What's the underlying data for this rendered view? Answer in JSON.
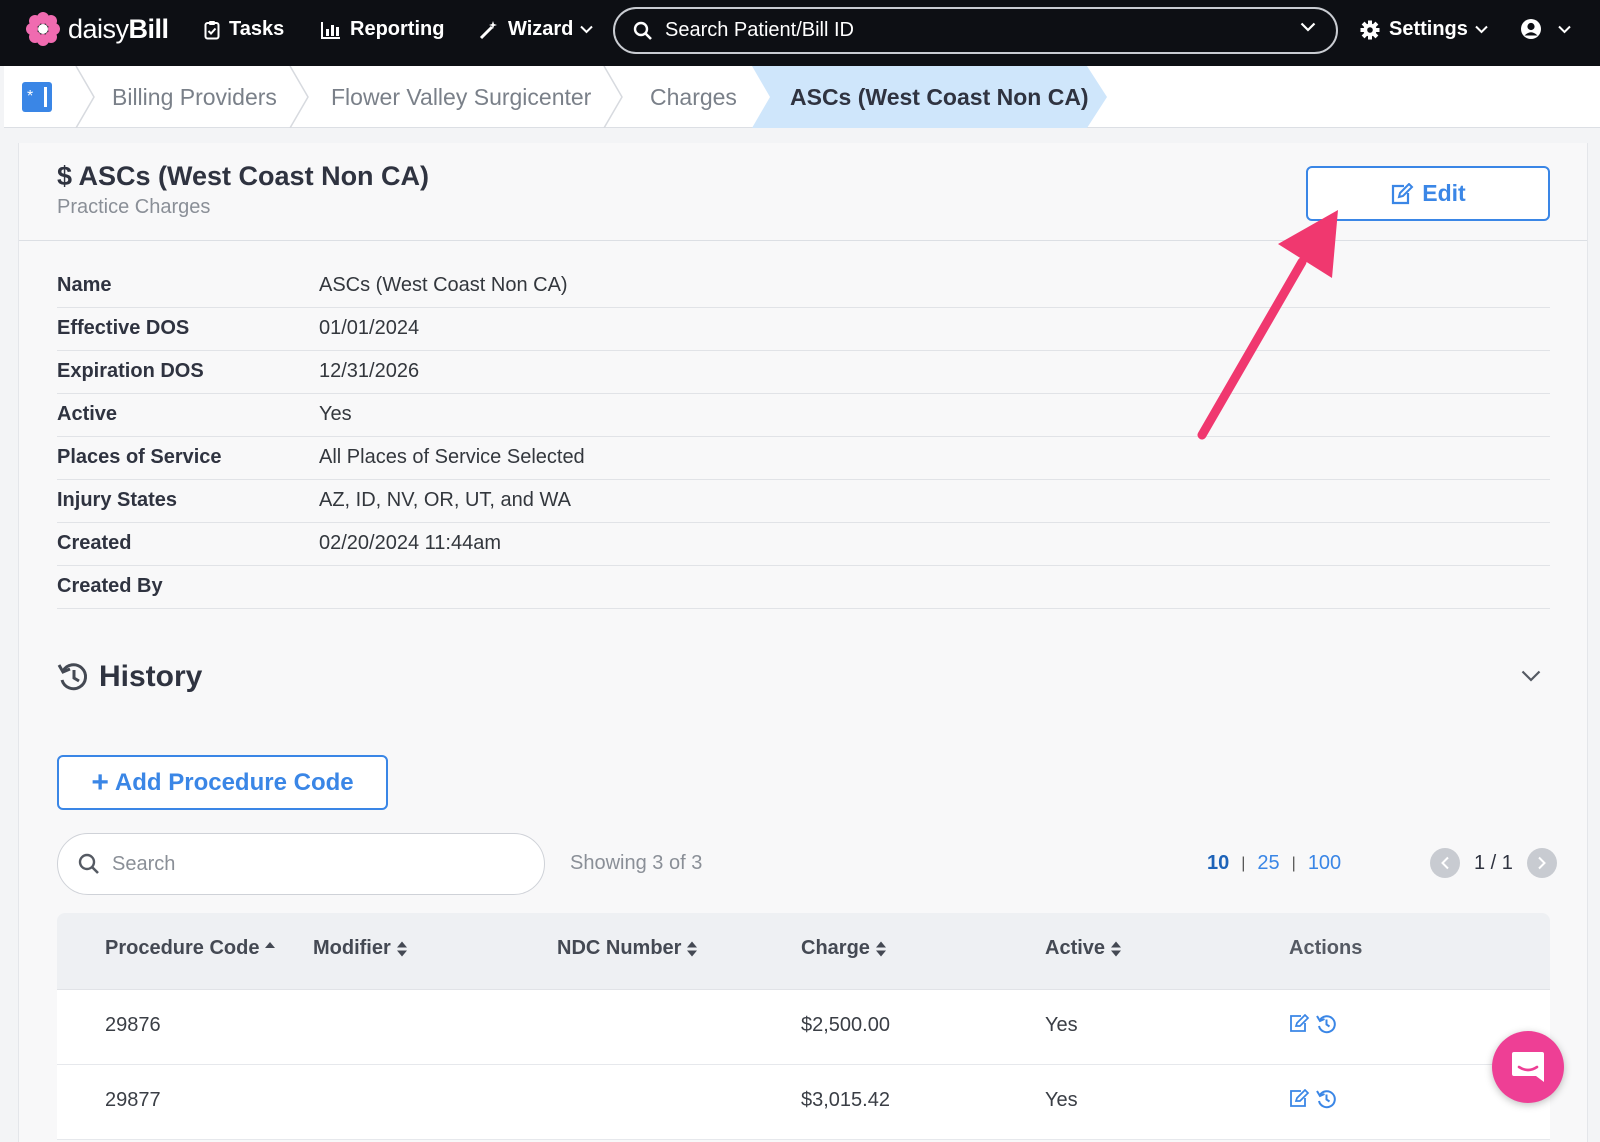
{
  "nav": {
    "brand_light": "daisy",
    "brand_bold": "Bill",
    "tasks": "Tasks",
    "reporting": "Reporting",
    "wizard": "Wizard",
    "search_placeholder": "Search Patient/Bill ID",
    "settings": "Settings"
  },
  "breadcrumb": {
    "items": [
      "Billing Providers",
      "Flower Valley Surgicenter",
      "Charges"
    ],
    "active": "ASCs (West Coast Non CA)"
  },
  "header": {
    "title": "$ ASCs (West Coast Non CA)",
    "subtitle": "Practice Charges",
    "edit_label": "Edit"
  },
  "details": [
    {
      "label": "Name",
      "value": "ASCs (West Coast Non CA)"
    },
    {
      "label": "Effective DOS",
      "value": "01/01/2024"
    },
    {
      "label": "Expiration DOS",
      "value": "12/31/2026"
    },
    {
      "label": "Active",
      "value": "Yes"
    },
    {
      "label": "Places of Service",
      "value": "All Places of Service Selected"
    },
    {
      "label": "Injury States",
      "value": "AZ, ID, NV, OR, UT, and WA"
    },
    {
      "label": "Created",
      "value": "02/20/2024 11:44am"
    },
    {
      "label": "Created By",
      "value": ""
    }
  ],
  "history": {
    "title": "History"
  },
  "actions": {
    "add_procedure_label": "Add Procedure Code"
  },
  "search": {
    "placeholder": "Search"
  },
  "showing": "Showing 3 of 3",
  "per_page": {
    "options": [
      "10",
      "25",
      "100"
    ],
    "selected": "10"
  },
  "pagination": {
    "text": "1 / 1"
  },
  "table": {
    "columns": [
      "Procedure Code",
      "Modifier",
      "NDC Number",
      "Charge",
      "Active",
      "Actions"
    ],
    "rows": [
      {
        "code": "29876",
        "modifier": "",
        "ndc": "",
        "charge": "$2,500.00",
        "active": "Yes"
      },
      {
        "code": "29877",
        "modifier": "",
        "ndc": "",
        "charge": "$3,015.42",
        "active": "Yes"
      }
    ]
  },
  "colors": {
    "accent": "#3a86e6",
    "navbar": "#0d0f14",
    "annotation_arrow": "#f0386f",
    "chat": "#ee3f95"
  }
}
